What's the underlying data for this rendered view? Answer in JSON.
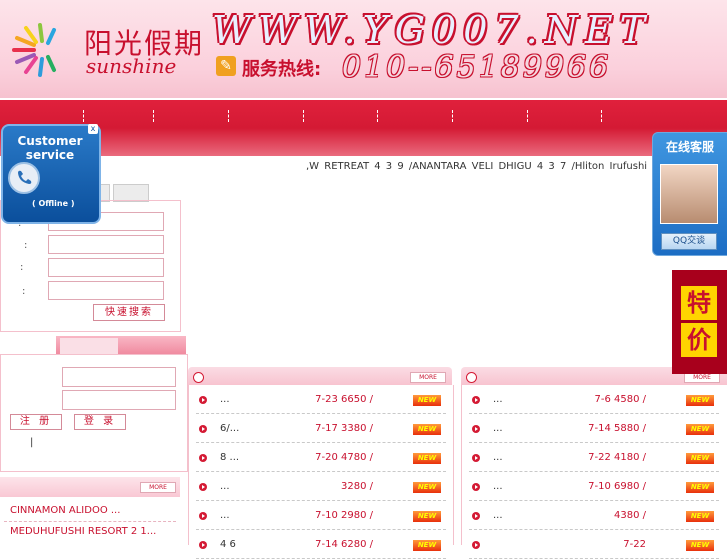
{
  "header": {
    "logo_cn": "阳光假期",
    "logo_en": "sunshine",
    "site_url": "WWW.YG007.NET",
    "hotline_label": "服务热线:",
    "hotline_number": "010--65189966"
  },
  "ticker": {
    "text": ",W RETREAT     4 3  9  /ANANTARA VELI DHIGU     4 3  7  /Hliton Irufushi"
  },
  "search": {
    "labels": [
      ":",
      ":",
      ":",
      ":"
    ],
    "quick_search": "快速搜索"
  },
  "login": {
    "register": "注 册",
    "login": "登 录",
    "separator": "|"
  },
  "hotels": {
    "more": "MORE",
    "items": [
      "CINNAMON ALIDOO    ...",
      "MEDUHUFUSHI RESORT 2 1..."
    ]
  },
  "left_panel": {
    "more": "MORE",
    "rows": [
      {
        "title": "...",
        "price": "7-23  6650 /",
        "badge": "NEW"
      },
      {
        "title": "6/...",
        "price": "7-17  3380 /",
        "badge": "NEW"
      },
      {
        "title": "8 ...",
        "price": "7-20  4780 /",
        "badge": "NEW"
      },
      {
        "title": "...",
        "price": "3280 /",
        "badge": "NEW"
      },
      {
        "title": "...",
        "price": "7-10  2980 /",
        "badge": "NEW"
      },
      {
        "title": "4 6",
        "price": "7-14  6280 /",
        "badge": "NEW"
      }
    ]
  },
  "right_panel": {
    "more": "MORE",
    "rows": [
      {
        "title": "...",
        "price": "7-6  4580 /",
        "badge": "NEW"
      },
      {
        "title": "...",
        "price": "7-14  5880 /",
        "badge": "NEW"
      },
      {
        "title": "...",
        "price": "7-22  4180 /",
        "badge": "NEW"
      },
      {
        "title": "...",
        "price": "7-10  6980 /",
        "badge": "NEW"
      },
      {
        "title": "...",
        "price": "4380 /",
        "badge": "NEW"
      },
      {
        "title": "",
        "price": "7-22",
        "badge": "NEW"
      }
    ]
  },
  "customer_service": {
    "title": "Customer service",
    "status": "( Offline )",
    "close": "x"
  },
  "online_service": {
    "title": "在线客服",
    "button": "QQ交谈"
  },
  "special": {
    "char1": "特",
    "char2": "价"
  }
}
